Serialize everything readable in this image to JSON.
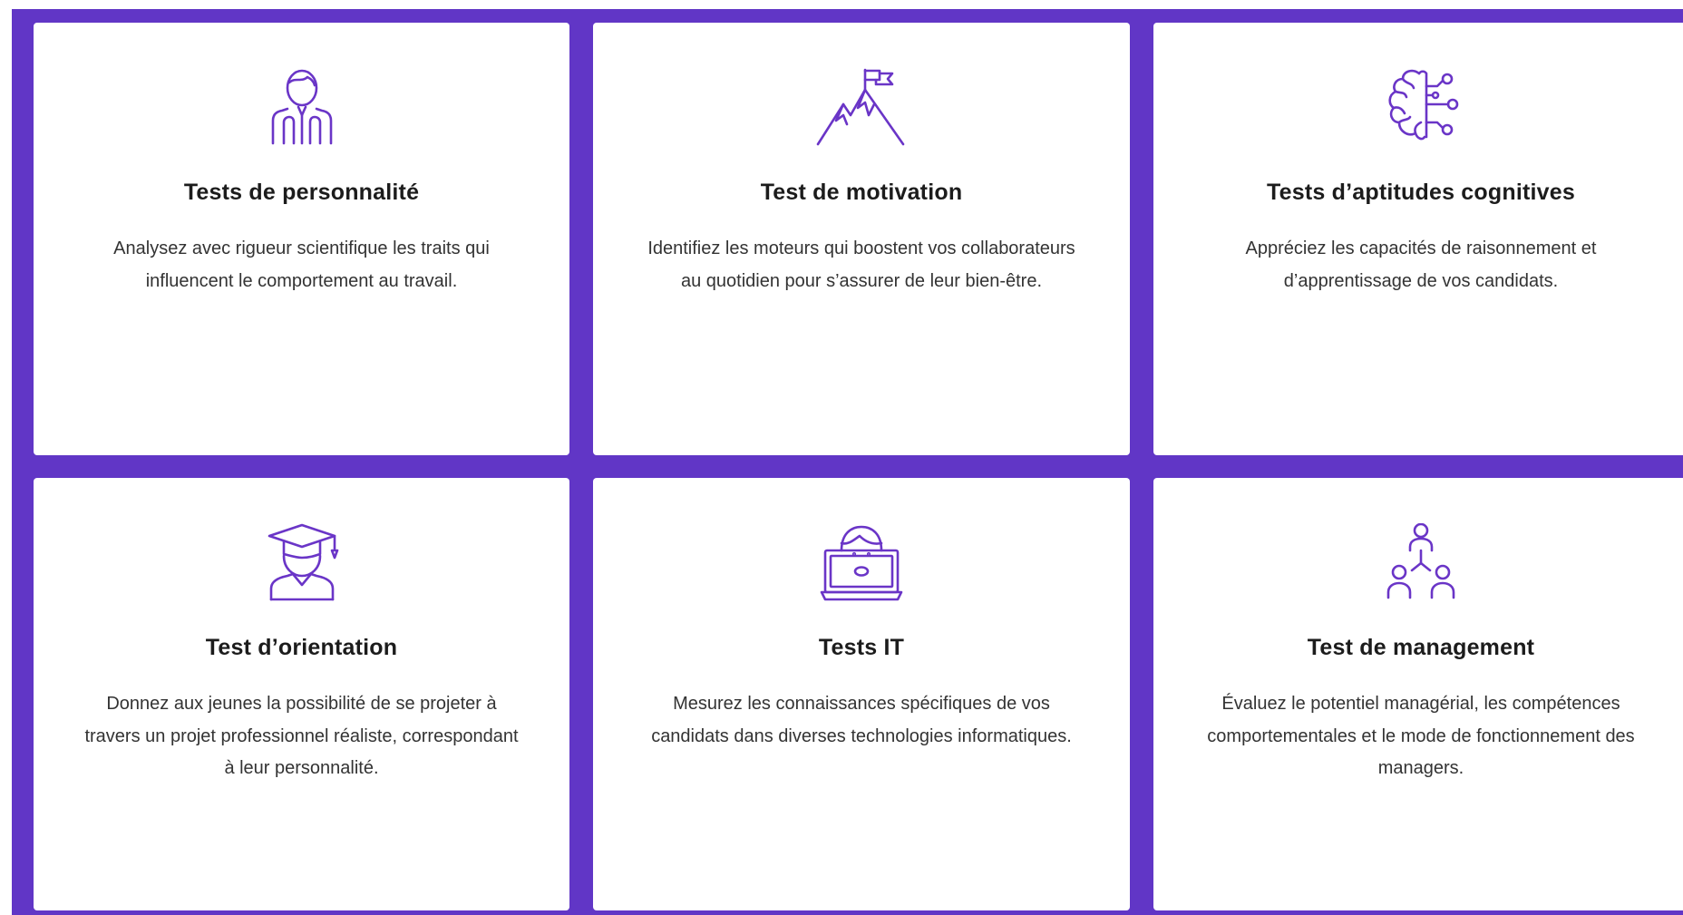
{
  "colors": {
    "background": "#6136c6",
    "card": "#ffffff",
    "icon": "#6a35c7",
    "title": "#1c1c1c",
    "text": "#333333"
  },
  "cards": [
    {
      "icon": "businessman-icon",
      "title": "Tests de personnalité",
      "description": "Analysez avec rigueur scientifique les traits qui influencent le comportement au travail."
    },
    {
      "icon": "mountain-flag-icon",
      "title": "Test de motivation",
      "description": "Identifiez les moteurs qui boostent vos collaborateurs au quotidien pour s’assurer de leur bien-être."
    },
    {
      "icon": "brain-circuit-icon",
      "title": "Tests d’aptitudes cognitives",
      "description": "Appréciez les capacités de raisonnement et d’apprentissage de vos candidats."
    },
    {
      "icon": "graduate-icon",
      "title": "Test d’orientation",
      "description": "Donnez aux jeunes la possibilité de se projeter à travers un projet professionnel réaliste, correspondant à leur personnalité."
    },
    {
      "icon": "developer-laptop-icon",
      "title": "Tests IT",
      "description": "Mesurez les connaissances spécifiques de vos candidats dans diverses technologies informatiques."
    },
    {
      "icon": "team-hierarchy-icon",
      "title": "Test de management",
      "description": "Évaluez le potentiel managérial, les compétences comportementales et le mode de fonctionnement des managers."
    }
  ]
}
